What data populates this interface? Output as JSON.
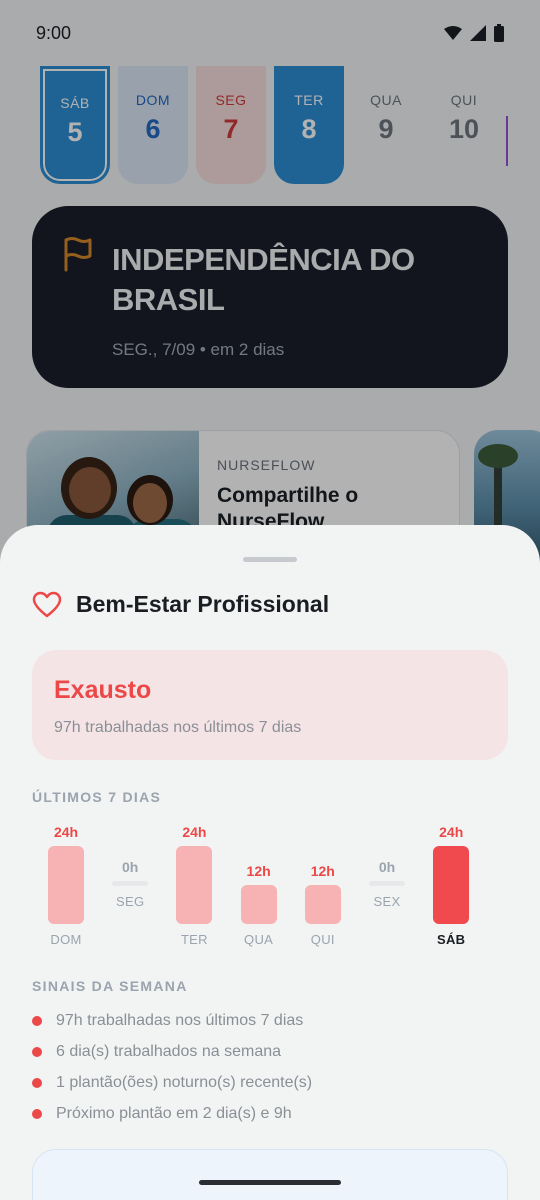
{
  "status_bar": {
    "time": "9:00"
  },
  "calendar": {
    "days": [
      {
        "name": "SÁB",
        "date": "5",
        "style": "sat"
      },
      {
        "name": "DOM",
        "date": "6",
        "style": "sun"
      },
      {
        "name": "SEG",
        "date": "7",
        "style": "mon"
      },
      {
        "name": "TER",
        "date": "8",
        "style": "tue"
      },
      {
        "name": "QUA",
        "date": "9",
        "style": "plain"
      },
      {
        "name": "QUI",
        "date": "10",
        "style": "plain"
      }
    ]
  },
  "holiday": {
    "title": "INDEPENDÊNCIA DO BRASIL",
    "subtitle": "SEG., 7/09 • em 2 dias",
    "icon": "flag-icon",
    "accent": "#d9892c"
  },
  "article": {
    "tag": "NURSEFLOW",
    "title": "Compartilhe o NurseFlow"
  },
  "wellbeing": {
    "icon": "heart-icon",
    "title": "Bem-Estar Profissional",
    "status_label": "Exausto",
    "status_desc": "97h trabalhadas nos últimos 7 dias",
    "status_color": "#ec4848",
    "last7_label": "ÚLTIMOS 7 DIAS",
    "signals_label": "SINAIS DA SEMANA",
    "signals": [
      "97h trabalhadas nos últimos 7 dias",
      "6 dia(s) trabalhados na semana",
      "1 plantão(ões) noturno(s) recente(s)",
      "Próximo plantão em 2 dia(s) e 9h"
    ]
  },
  "chart_data": {
    "type": "bar",
    "categories": [
      "DOM",
      "SEG",
      "TER",
      "QUA",
      "QUI",
      "SEX",
      "SÁB"
    ],
    "values": [
      24,
      0,
      24,
      12,
      12,
      0,
      24
    ],
    "labels": [
      "24h",
      "0h",
      "24h",
      "12h",
      "12h",
      "0h",
      "24h"
    ],
    "highlight": "SÁB",
    "colors": {
      "bar": "#f7b2b3",
      "highlight": "#f04a4f",
      "value_text": "#ec4848",
      "zero_text": "#9aa3ae"
    },
    "ylim": [
      0,
      24
    ]
  }
}
